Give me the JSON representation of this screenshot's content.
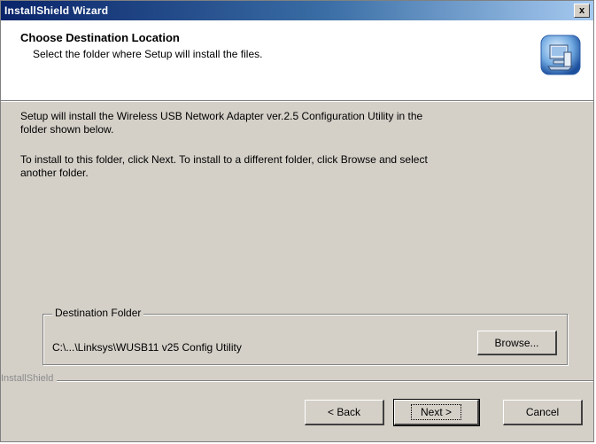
{
  "window": {
    "title": "InstallShield Wizard",
    "close_glyph": "x"
  },
  "header": {
    "title": "Choose Destination Location",
    "subtitle": "Select the folder where Setup will install the files.",
    "icon": "setup-computer-icon"
  },
  "body": {
    "paragraph1_line1": "Setup will install the Wireless USB Network Adapter ver.2.5 Configuration Utility in the",
    "paragraph1_line2": "folder shown below.",
    "paragraph2_line1": "To install to this folder, click Next. To install to a different folder, click Browse and select",
    "paragraph2_line2": "another folder."
  },
  "destination": {
    "legend": "Destination Folder",
    "path": "C:\\...\\Linksys\\WUSB11 v25 Config Utility",
    "browse_label": "Browse..."
  },
  "footer": {
    "brand": "InstallShield",
    "back_label": "< Back",
    "next_label": "Next >",
    "cancel_label": "Cancel"
  }
}
